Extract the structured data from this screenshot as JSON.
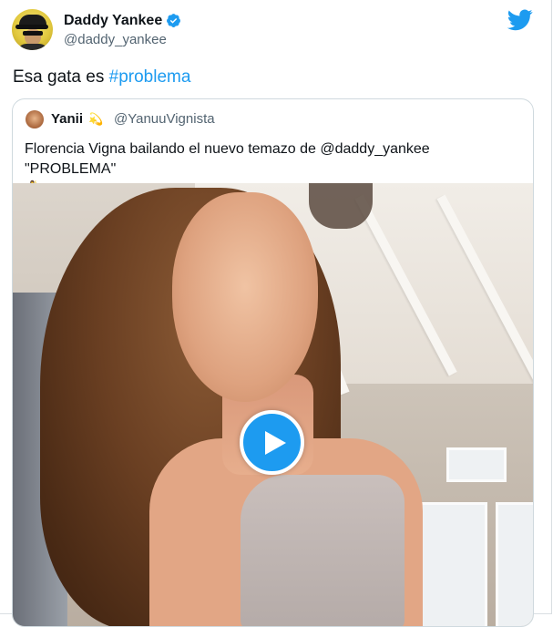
{
  "author": {
    "name": "Daddy Yankee",
    "handle": "@daddy_yankee",
    "verified": true
  },
  "tweet": {
    "text_prefix": "Esa gata es ",
    "hashtag": "#problema"
  },
  "quoted": {
    "name": "Yanii",
    "name_emoji": "💫",
    "handle": "@YanuuVignista",
    "line1": "Florencia Vigna bailando el nuevo temazo de @daddy_yankee",
    "line2_text": "\"PROBLEMA\" ",
    "line2_emoji1": "💃",
    "line2_emoji2": "😎"
  },
  "media": {
    "type": "video",
    "play_icon": "play-icon"
  },
  "colors": {
    "accent": "#1d9bf0",
    "text": "#0f1419",
    "secondary": "#536471"
  },
  "icons": {
    "platform": "twitter-bird-icon",
    "verified": "verified-badge-icon"
  }
}
